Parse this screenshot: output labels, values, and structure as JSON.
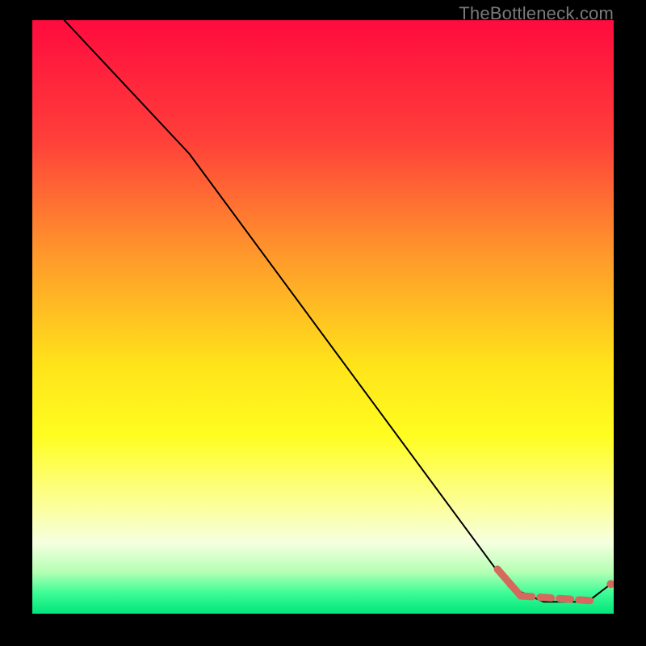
{
  "attribution": "TheBottleneck.com",
  "chart_data": {
    "type": "line",
    "title": "",
    "xlabel": "",
    "ylabel": "",
    "xlim": [
      0,
      100
    ],
    "ylim": [
      0,
      100
    ],
    "gradient_stops": [
      {
        "offset": 0.0,
        "color": "#ff0b3e"
      },
      {
        "offset": 0.2,
        "color": "#ff3f3a"
      },
      {
        "offset": 0.4,
        "color": "#ff9a2b"
      },
      {
        "offset": 0.58,
        "color": "#ffe31a"
      },
      {
        "offset": 0.7,
        "color": "#fffd20"
      },
      {
        "offset": 0.82,
        "color": "#fcff9c"
      },
      {
        "offset": 0.88,
        "color": "#f6ffe0"
      },
      {
        "offset": 0.93,
        "color": "#b4ffb4"
      },
      {
        "offset": 0.965,
        "color": "#3dfc96"
      },
      {
        "offset": 1.0,
        "color": "#00e57a"
      }
    ],
    "series": [
      {
        "name": "bottleneck-curve",
        "style": "solid-thin",
        "color": "#000000",
        "points": [
          {
            "x": 5.5,
            "y": 100.0
          },
          {
            "x": 27.0,
            "y": 77.5
          },
          {
            "x": 82.0,
            "y": 4.5
          },
          {
            "x": 88.0,
            "y": 2.0
          },
          {
            "x": 95.5,
            "y": 2.0
          },
          {
            "x": 99.5,
            "y": 5.0
          }
        ]
      },
      {
        "name": "optimal-band-thick",
        "style": "solid-thick",
        "color": "#d46a5e",
        "points": [
          {
            "x": 80.0,
            "y": 7.5
          },
          {
            "x": 84.0,
            "y": 3.0
          }
        ]
      },
      {
        "name": "optimal-band-dashed",
        "style": "dashed-thick",
        "color": "#d46a5e",
        "points": [
          {
            "x": 84.0,
            "y": 3.0
          },
          {
            "x": 96.0,
            "y": 2.2
          }
        ]
      },
      {
        "name": "end-marker",
        "style": "point",
        "color": "#d46a5e",
        "points": [
          {
            "x": 99.5,
            "y": 5.0
          }
        ]
      }
    ]
  }
}
